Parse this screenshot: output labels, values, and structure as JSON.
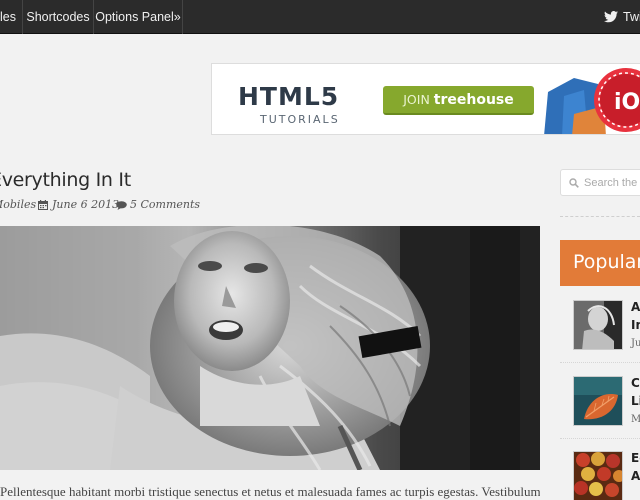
{
  "nav": {
    "items": [
      {
        "label": "Mobiles"
      },
      {
        "label": "Shortcodes"
      },
      {
        "label": "Options Panel»"
      }
    ],
    "twitter_label": "Twitter"
  },
  "banner": {
    "title": "HTML5",
    "subtitle": "TUTORIALS",
    "cta_prefix": "JOIN",
    "cta_brand": "treehouse",
    "badge_text": "iO"
  },
  "post": {
    "title": "Everything In It",
    "author": "Mobiles",
    "date": "June 6 2013",
    "comments": "5 Comments",
    "excerpt": "Pellentesque habitant morbi tristique senectus et netus et malesuada fames ac turpis egestas. Vestibulum tortor quam, feugiat"
  },
  "sidebar": {
    "search_placeholder": "Search the site",
    "popular_label": "Popular",
    "popular_items": [
      {
        "line1": "Av",
        "line2": "In",
        "meta": "Ju"
      },
      {
        "line1": "Cl",
        "line2": "Lit",
        "meta": "M"
      },
      {
        "line1": "Eg",
        "line2": "Au",
        "meta": ""
      }
    ]
  },
  "colors": {
    "topbar": "#2b2b2b",
    "accent": "#e27b38",
    "cta_green": "#86a82d",
    "page_bg": "#f2f2f2"
  },
  "icons": {
    "twitter": "twitter-bird-icon",
    "calendar": "calendar-icon",
    "comment": "speech-bubble-icon",
    "search": "search-icon"
  }
}
